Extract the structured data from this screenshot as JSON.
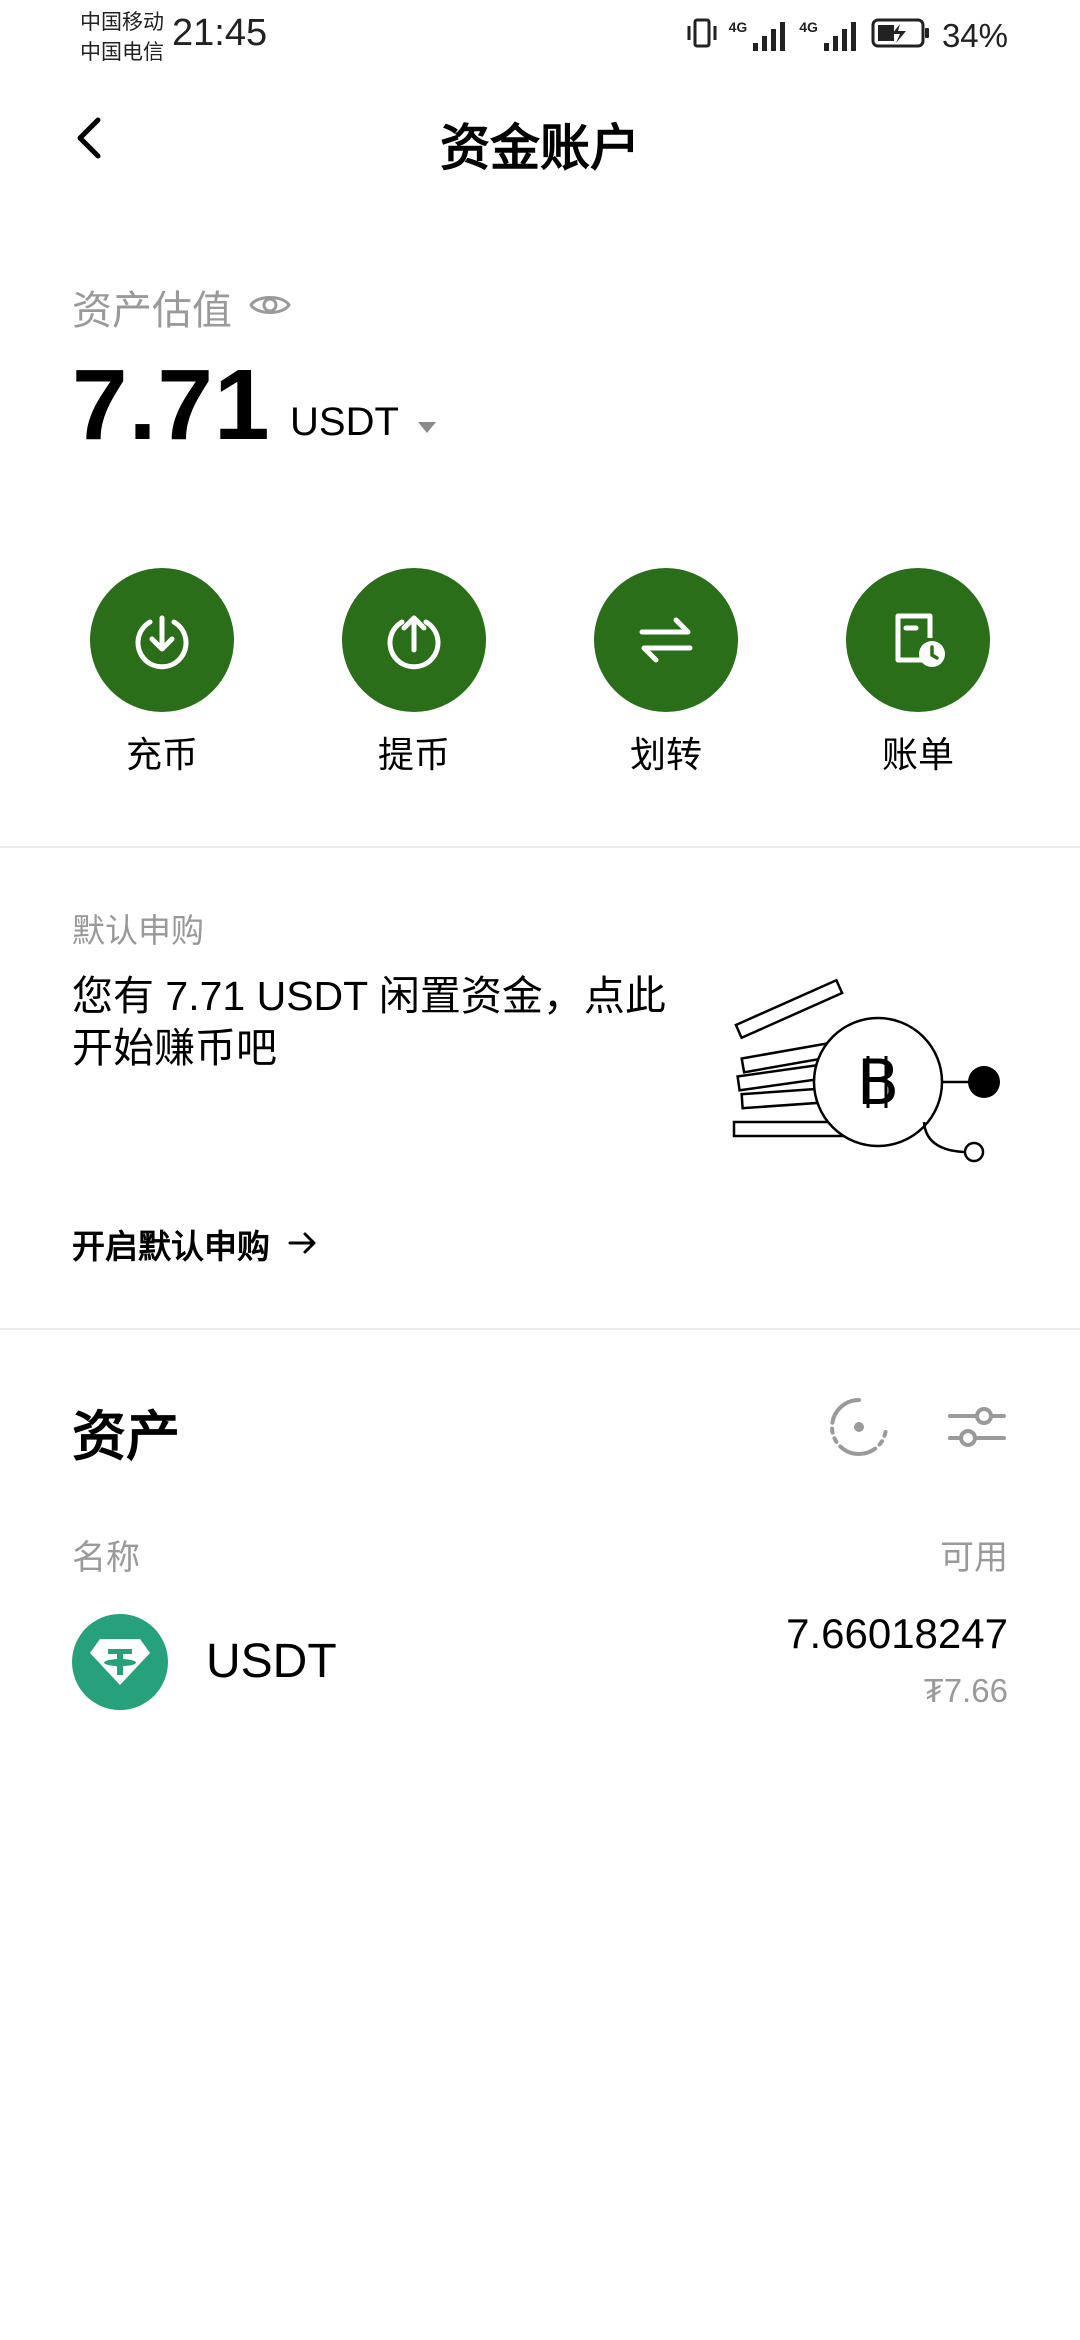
{
  "status_bar": {
    "carrier_1": "中国移动",
    "carrier_2": "中国电信",
    "time": "21:45",
    "network_1": "4G",
    "network_2": "4G",
    "battery": "34%"
  },
  "header": {
    "title": "资金账户"
  },
  "valuation": {
    "label": "资产估值",
    "amount": "7.71",
    "unit": "USDT"
  },
  "actions": [
    {
      "label": "充币",
      "icon": "deposit-icon"
    },
    {
      "label": "提币",
      "icon": "withdraw-icon"
    },
    {
      "label": "划转",
      "icon": "transfer-icon"
    },
    {
      "label": "账单",
      "icon": "bill-icon"
    }
  ],
  "promo": {
    "label": "默认申购",
    "text": "您有 7.71 USDT 闲置资金，点此开始赚币吧",
    "link": "开启默认申购"
  },
  "assets": {
    "title": "资产",
    "col_name": "名称",
    "col_available": "可用",
    "rows": [
      {
        "name": "USDT",
        "quantity": "7.66018247",
        "fiat": "₮7.66"
      }
    ]
  },
  "colors": {
    "accent": "#2a6e1a",
    "usdt": "#26a17b",
    "muted": "#9a9a9a"
  }
}
